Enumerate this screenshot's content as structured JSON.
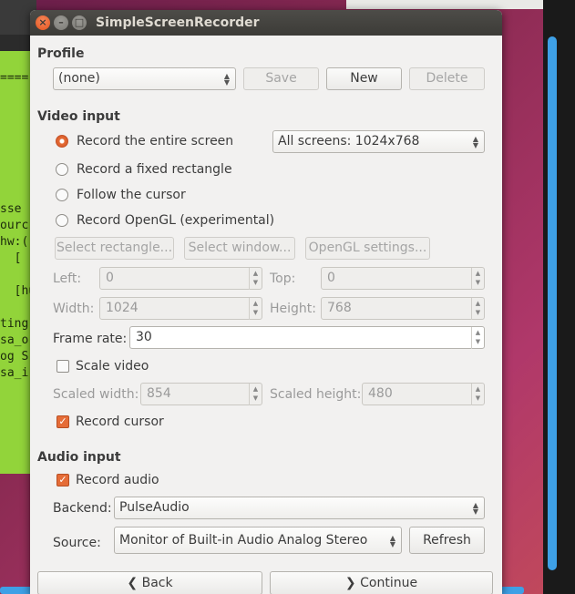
{
  "window": {
    "title": "SimpleScreenRecorder"
  },
  "terminal": {
    "lines": [
      "====",
      "sse",
      "ourc",
      "hw:(",
      "  [",
      "  [hu",
      "ting",
      "sa_o",
      "og S",
      "sa_i"
    ]
  },
  "profile": {
    "heading": "Profile",
    "selected": "(none)",
    "save": "Save",
    "new": "New",
    "delete": "Delete"
  },
  "video": {
    "heading": "Video input",
    "opt_entire": "Record the entire screen",
    "opt_rect": "Record a fixed rectangle",
    "opt_cursor": "Follow the cursor",
    "opt_opengl": "Record OpenGL (experimental)",
    "screens": "All screens: 1024x768",
    "select_rect": "Select rectangle...",
    "select_window": "Select window...",
    "opengl_settings": "OpenGL settings...",
    "left_label": "Left:",
    "left_value": "0",
    "top_label": "Top:",
    "top_value": "0",
    "width_label": "Width:",
    "width_value": "1024",
    "height_label": "Height:",
    "height_value": "768",
    "framerate_label": "Frame rate:",
    "framerate_value": "30",
    "scale_label": "Scale video",
    "scale_checked": false,
    "scaled_width_label": "Scaled width:",
    "scaled_width_value": "854",
    "scaled_height_label": "Scaled height:",
    "scaled_height_value": "480",
    "cursor_label": "Record cursor",
    "cursor_checked": true
  },
  "audio": {
    "heading": "Audio input",
    "record_label": "Record audio",
    "record_checked": true,
    "backend_label": "Backend:",
    "backend_value": "PulseAudio",
    "source_label": "Source:",
    "source_value": "Monitor of Built-in Audio Analog Stereo",
    "refresh": "Refresh"
  },
  "nav": {
    "back": "Back",
    "continue": "Continue"
  },
  "colors": {
    "accent": "#e56c37",
    "titlebar": "#3c3b37",
    "window_bg": "#f2f1f0"
  }
}
